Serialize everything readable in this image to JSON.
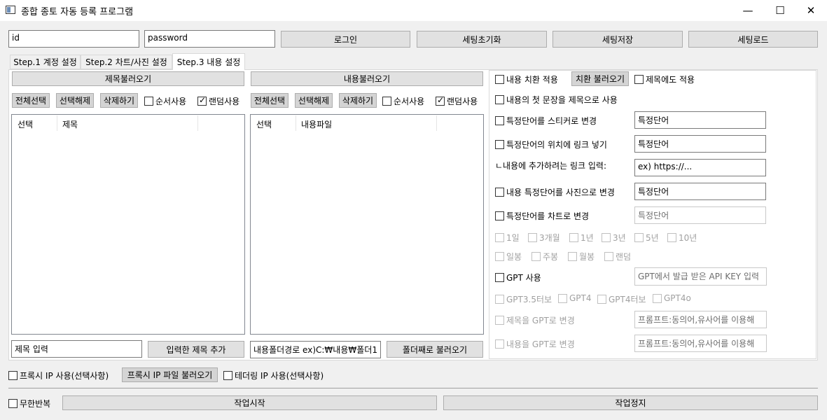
{
  "window": {
    "title": "종합 종토 자동 등록 프로그램",
    "minimize": "—",
    "maximize": "☐",
    "close": "✕"
  },
  "login": {
    "id_value": "id",
    "password_value": "password",
    "login_label": "로그인",
    "reset_label": "세팅초기화",
    "save_label": "세팅저장",
    "load_label": "세팅로드"
  },
  "tabs": [
    {
      "label": "Step.1 계정 설정"
    },
    {
      "label": "Step.2 차트/사진 설정"
    },
    {
      "label": "Step.3 내용 설정"
    }
  ],
  "title_panel": {
    "load_label": "제목불러오기",
    "select_all": "전체선택",
    "deselect": "선택해제",
    "delete": "삭제하기",
    "sequential": "순서사용",
    "random": "랜덤사용",
    "col_select": "선택",
    "col_title": "제목",
    "input_value": "제목 입력",
    "add_label": "입력한 제목 추가"
  },
  "content_panel": {
    "load_label": "내용불러오기",
    "select_all": "전체선택",
    "deselect": "선택해제",
    "delete": "삭제하기",
    "sequential": "순서사용",
    "random": "랜덤사용",
    "col_select": "선택",
    "col_file": "내용파일",
    "folder_value": "내용폴더경로 ex)C:₩내용₩폴더1",
    "folder_load_label": "폴더째로 불러오기"
  },
  "options": {
    "replace": "내용 치환 적용",
    "replace_load": "치환 불러오기",
    "apply_title": "제목에도 적용",
    "first_sentence": "내용의 첫 문장을 제목으로 사용",
    "sticker": "특정단어를 스티커로 변경",
    "sticker_value": "특정단어",
    "link": "특정단어의 위치에 링크 넣기",
    "link_value": "특정단어",
    "link_input_label": "ㄴ내용에 추가하려는 링크 입력:",
    "link_input_value": "ex) https://...",
    "photo": "내용 특정단어를 사진으로 변경",
    "photo_value": "특정단어",
    "chart": "특정단어를 차트로 변경",
    "chart_value": "특정단어",
    "periods": [
      "1일",
      "3개월",
      "1년",
      "3년",
      "5년",
      "10년"
    ],
    "candles": [
      "일봉",
      "주봉",
      "월봉",
      "랜덤"
    ],
    "gpt_use": "GPT 사용",
    "gpt_key_placeholder": "GPT에서 발급 받은 API KEY 입력",
    "gpt_models": [
      "GPT3.5터보",
      "GPT4",
      "GPT4터보",
      "GPT4o"
    ],
    "gpt_title": "제목을 GPT로 변경",
    "gpt_title_prompt": "프롬프트:동의어,유사어를 이용해",
    "gpt_content": "내용을 GPT로 변경",
    "gpt_content_prompt": "프롬프트:동의어,유사어를 이용해"
  },
  "footer": {
    "proxy": "프록시 IP 사용(선택사항)",
    "proxy_load": "프록시 IP 파일 불러오기",
    "tethering": "테더링 IP 사용(선택사항)",
    "infinite": "무한반복",
    "start": "작업시작",
    "stop": "작업정지"
  }
}
